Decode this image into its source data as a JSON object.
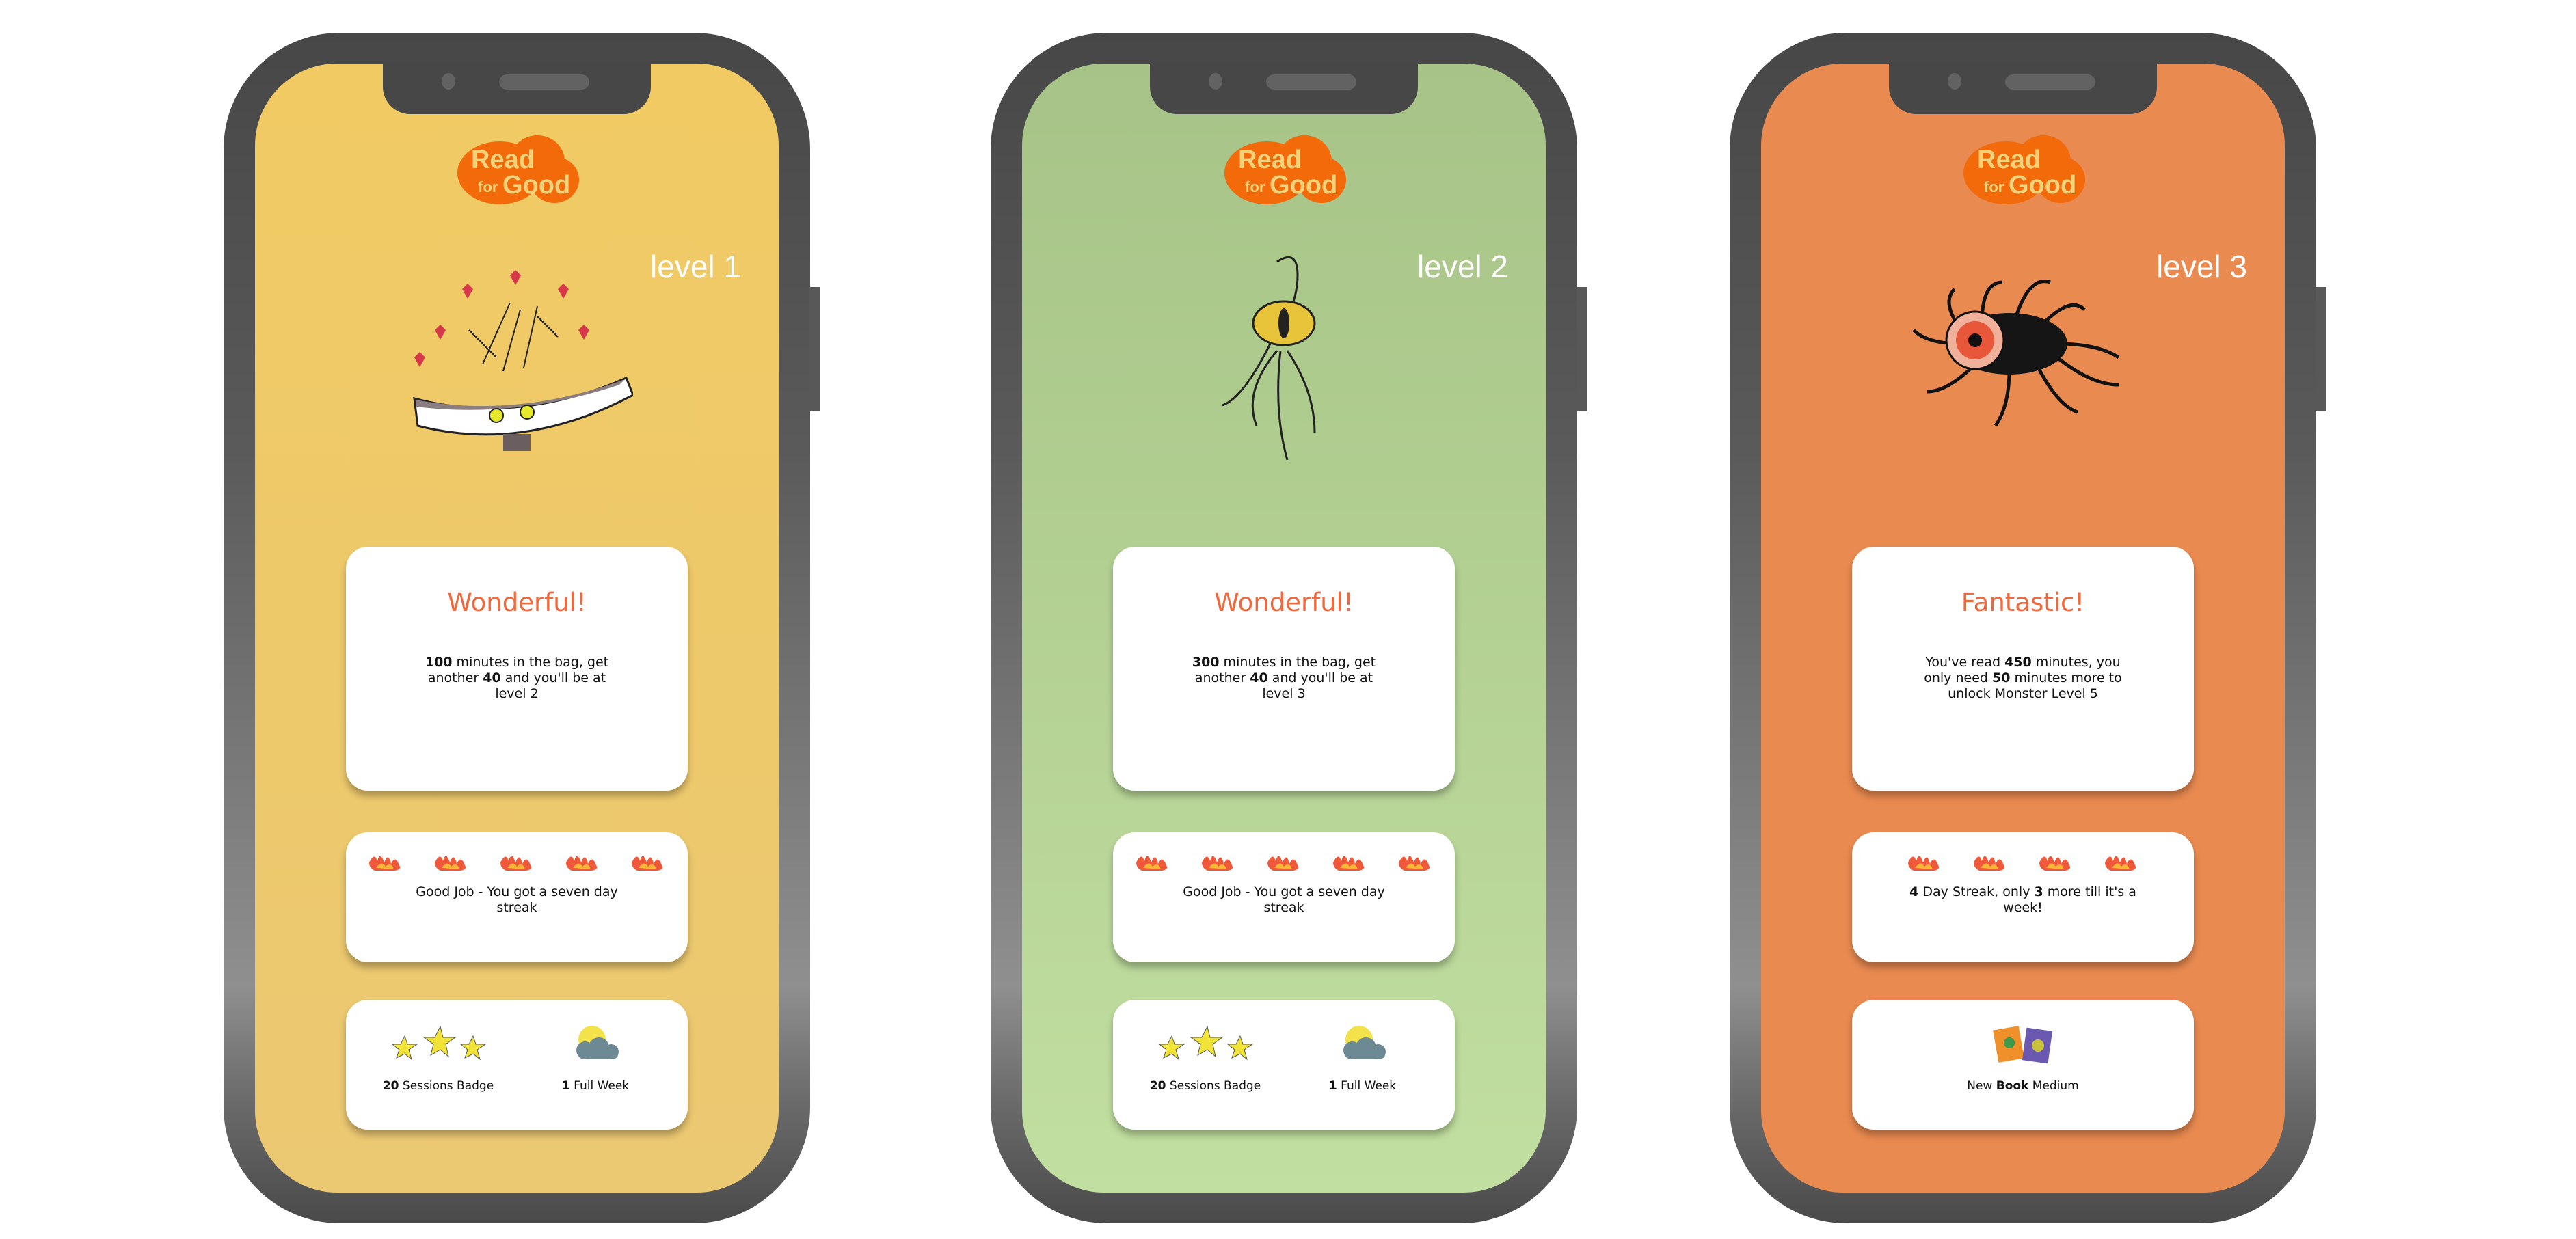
{
  "brand": {
    "logo_text": "Read for Good",
    "accent": "#f26a35"
  },
  "phones": [
    {
      "bg": "#f0c964",
      "level": "level 1",
      "progress": {
        "title": "Wonderful!",
        "parts": [
          {
            "b": "100"
          },
          {
            "t": " minutes in the bag, get another "
          },
          {
            "b": "40"
          },
          {
            "t": " and you'll be at level 2"
          }
        ]
      },
      "streak": {
        "flames": 5,
        "parts": [
          {
            "t": "Good Job - You got a seven day streak"
          }
        ]
      },
      "badges": [
        {
          "icon": "stars-icon",
          "count": "20",
          "label": " Sessions Badge"
        },
        {
          "icon": "sun-cloud-icon",
          "count": "1",
          "label": " Full Week"
        }
      ]
    },
    {
      "bg": "#b5d293",
      "level": "level 2",
      "progress": {
        "title": "Wonderful!",
        "parts": [
          {
            "b": "300"
          },
          {
            "t": " minutes in the bag, get another "
          },
          {
            "b": "40"
          },
          {
            "t": " and you'll be at level 3"
          }
        ]
      },
      "streak": {
        "flames": 5,
        "parts": [
          {
            "t": "Good Job - You got a seven day streak"
          }
        ]
      },
      "badges": [
        {
          "icon": "stars-icon",
          "count": "20",
          "label": " Sessions Badge"
        },
        {
          "icon": "sun-cloud-icon",
          "count": "1",
          "label": " Full Week"
        }
      ]
    },
    {
      "bg": "#e98a50",
      "level": "level 3",
      "progress": {
        "title": "Fantastic!",
        "parts": [
          {
            "t": "You've read "
          },
          {
            "b": "450"
          },
          {
            "t": " minutes, you only need "
          },
          {
            "b": "50"
          },
          {
            "t": " minutes more to unlock Monster Level 5"
          }
        ]
      },
      "streak": {
        "flames": 4,
        "parts": [
          {
            "b": "4"
          },
          {
            "t": " Day Streak, only "
          },
          {
            "b": "3"
          },
          {
            "t": " more till it's a week!"
          }
        ]
      },
      "reward": {
        "icon": "books-icon",
        "parts": [
          {
            "t": "New "
          },
          {
            "b": "Book"
          },
          {
            "t": " Medium"
          }
        ]
      }
    }
  ]
}
